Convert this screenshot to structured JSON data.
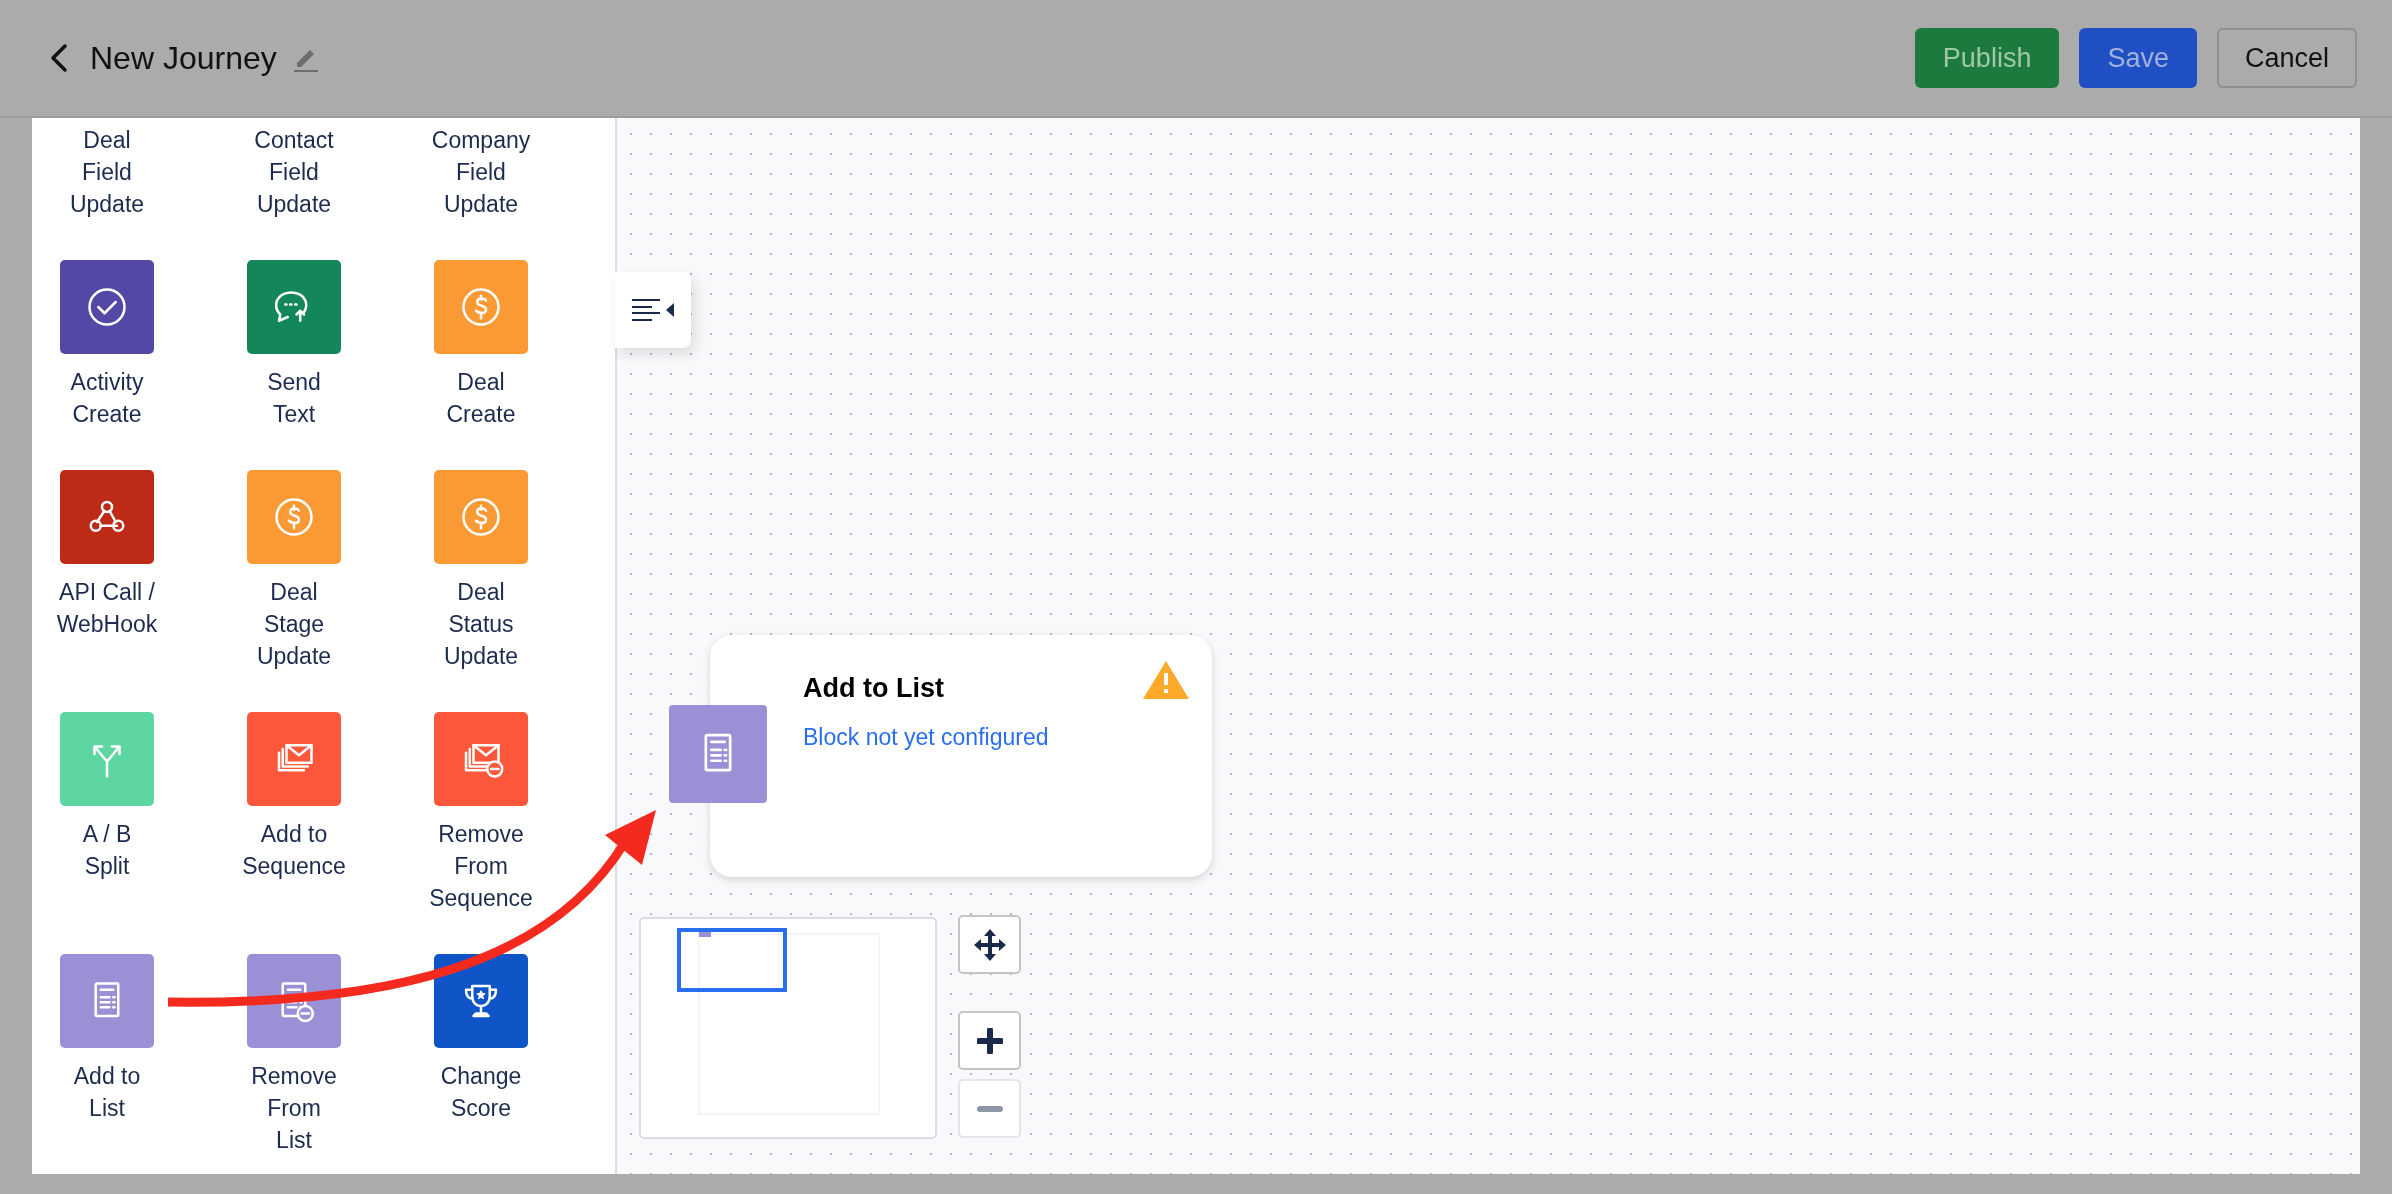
{
  "header": {
    "title": "New Journey",
    "buttons": [
      {
        "label": "Publish",
        "kind": "publish"
      },
      {
        "label": "Save",
        "kind": "save"
      },
      {
        "label": "Cancel",
        "kind": "cancel"
      }
    ]
  },
  "palette": {
    "items": [
      {
        "label": "Deal\nField\nUpdate"
      },
      {
        "label": "Contact\nField\nUpdate"
      },
      {
        "label": "Company\nField\nUpdate"
      },
      {
        "label": "Activity\nCreate",
        "kind": "check",
        "color": "#5448a6"
      },
      {
        "label": "Send\nText",
        "kind": "chat",
        "color": "#13875a"
      },
      {
        "label": "Deal\nCreate",
        "kind": "dollar",
        "color": "#fb9a35"
      },
      {
        "label": "API Call /\nWebHook",
        "kind": "webhook",
        "color": "#bd2a15"
      },
      {
        "label": "Deal\nStage\nUpdate",
        "kind": "dollar",
        "color": "#fb9a35"
      },
      {
        "label": "Deal\nStatus\nUpdate",
        "kind": "dollar",
        "color": "#fb9a35"
      },
      {
        "label": "A / B\nSplit",
        "kind": "split",
        "color": "#5dd6a2"
      },
      {
        "label": "Add to\nSequence",
        "kind": "mail",
        "color": "#fd573b"
      },
      {
        "label": "Remove\nFrom\nSequence",
        "kind": "mail-minus",
        "color": "#fd573b"
      },
      {
        "label": "Add to\nList",
        "kind": "list",
        "color": "#9a90d6"
      },
      {
        "label": "Remove\nFrom\nList",
        "kind": "list-minus",
        "color": "#9a90d6"
      },
      {
        "label": "Change\nScore",
        "kind": "trophy",
        "color": "#0f55c8"
      }
    ]
  },
  "canvas": {
    "node": {
      "title": "Add to List",
      "status": "Block not yet configured",
      "warning": true,
      "kind": "list",
      "color": "#9a90d6"
    },
    "zoom_controls": [
      {
        "kind": "move",
        "disabled": false
      },
      {
        "kind": "plus",
        "disabled": false
      },
      {
        "kind": "minus",
        "disabled": true
      }
    ]
  }
}
